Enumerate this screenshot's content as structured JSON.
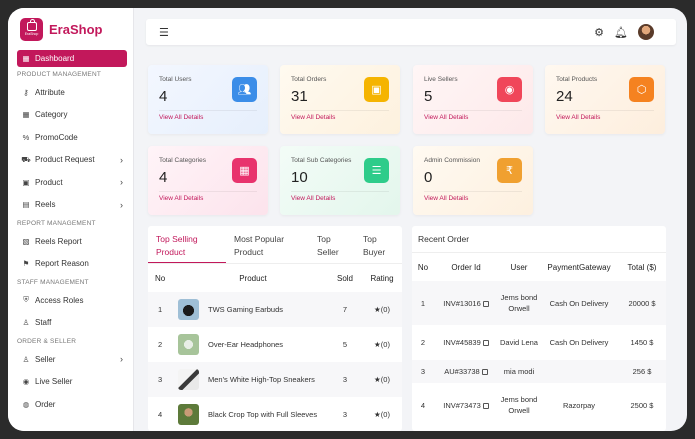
{
  "app": {
    "name": "EraShop",
    "logo_mini": "EraShop",
    "brand_color": "#c2185b"
  },
  "sidebar": {
    "dashboard": "Dashboard",
    "sections": {
      "product_management": "PRODUCT MANAGEMENT",
      "report_management": "REPORT MANAGEMENT",
      "staff_management": "STAFF MANAGEMENT",
      "order_seller": "ORDER & SELLER"
    },
    "items": {
      "attribute": "Attribute",
      "category": "Category",
      "promocode": "PromoCode",
      "product_request": "Product Request",
      "product": "Product",
      "reels": "Reels",
      "reels_report": "Reels Report",
      "report_reason": "Report Reason",
      "access_roles": "Access Roles",
      "staff": "Staff",
      "seller": "Seller",
      "live_seller": "Live Seller",
      "order": "Order"
    }
  },
  "topbar": {
    "menu_icon": "hamburger-icon",
    "settings_icon": "gear-icon",
    "notification_icon": "bell-icon"
  },
  "cards": [
    {
      "label": "Total Users",
      "value": "4",
      "link": "View All Details",
      "icon": "users-icon",
      "color": "#3b8de8"
    },
    {
      "label": "Total Orders",
      "value": "31",
      "link": "View All Details",
      "icon": "bag-icon",
      "color": "#f5b400"
    },
    {
      "label": "Live Sellers",
      "value": "5",
      "link": "View All Details",
      "icon": "broadcast-icon",
      "color": "#f0465a"
    },
    {
      "label": "Total Products",
      "value": "24",
      "link": "View All Details",
      "icon": "box-icon",
      "color": "#f58220"
    },
    {
      "label": "Total Categories",
      "value": "4",
      "link": "View All Details",
      "icon": "grid-icon",
      "color": "#e8336d"
    },
    {
      "label": "Total Sub Categories",
      "value": "10",
      "link": "View All Details",
      "icon": "list-icon",
      "color": "#2ecc8a"
    },
    {
      "label": "Admin Commission",
      "value": "0",
      "link": "View All Details",
      "icon": "rupee-icon",
      "color": "#f0a030"
    }
  ],
  "products_panel": {
    "tabs": [
      "Top Selling Product",
      "Most Popular Product",
      "Top Seller",
      "Top Buyer"
    ],
    "headers": {
      "no": "No",
      "product": "Product",
      "sold": "Sold",
      "rating": "Rating"
    },
    "rows": [
      {
        "no": "1",
        "name": "TWS Gaming Earbuds",
        "sold": "7",
        "rating": "★(0)"
      },
      {
        "no": "2",
        "name": "Over-Ear Headphones",
        "sold": "5",
        "rating": "★(0)"
      },
      {
        "no": "3",
        "name": "Men's White High-Top Sneakers",
        "sold": "3",
        "rating": "★(0)"
      },
      {
        "no": "4",
        "name": "Black Crop Top with Full Sleeves",
        "sold": "3",
        "rating": "★(0)"
      }
    ]
  },
  "orders_panel": {
    "title": "Recent Order",
    "headers": {
      "no": "No",
      "order_id": "Order Id",
      "user": "User",
      "gateway": "PaymentGateway",
      "total": "Total ($)"
    },
    "rows": [
      {
        "no": "1",
        "order_id": "INV#13016",
        "user": "Jems bond Orwell",
        "gateway": "Cash On Delivery",
        "total": "20000 $"
      },
      {
        "no": "2",
        "order_id": "INV#45839",
        "user": "David Lena",
        "gateway": "Cash On Delivery",
        "total": "1450 $"
      },
      {
        "no": "3",
        "order_id": "AU#33738",
        "user": "mia modi",
        "gateway": "",
        "total": "256 $"
      },
      {
        "no": "4",
        "order_id": "INV#73473",
        "user": "Jems bond Orwell",
        "gateway": "Razorpay",
        "total": "2500 $"
      }
    ]
  }
}
